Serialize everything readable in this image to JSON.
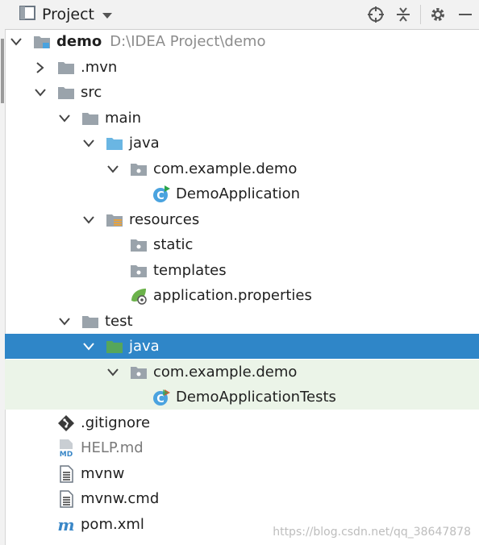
{
  "header": {
    "title": "Project"
  },
  "tree": {
    "root": {
      "name": "demo",
      "path": "D:\\IDEA Project\\demo"
    },
    "mvn": ".mvn",
    "src": "src",
    "main": "main",
    "main_java": "java",
    "main_pkg": "com.example.demo",
    "app_class": "DemoApplication",
    "resources": "resources",
    "static": "static",
    "templates": "templates",
    "app_props": "application.properties",
    "test": "test",
    "test_java": "java",
    "test_pkg": "com.example.demo",
    "test_class": "DemoApplicationTests",
    "gitignore": ".gitignore",
    "help": "HELP.md",
    "mvnw": "mvnw",
    "mvnw_cmd": "mvnw.cmd",
    "pom": "pom.xml"
  },
  "watermark": "https://blog.csdn.net/qq_38647878",
  "colors": {
    "selection": "#2f86c8",
    "test_tint": "#ebf4e8",
    "folder": "#9aa3ab",
    "source_folder": "#6ab6e3",
    "test_folder": "#56a65b"
  }
}
